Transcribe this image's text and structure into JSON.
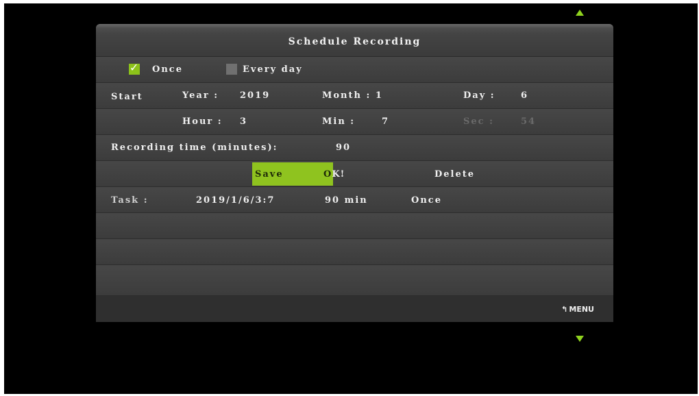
{
  "title": "Schedule Recording",
  "mode": {
    "once_label": "Once",
    "once_checked": true,
    "everyday_label": "Every day",
    "everyday_checked": false
  },
  "start": {
    "label": "Start",
    "year_label": "Year :",
    "year": "2019",
    "month_label": "Month : 1",
    "day_label": "Day :",
    "day": "6",
    "hour_label": "Hour :",
    "hour": "3",
    "min_label": "Min :",
    "min": "7",
    "sec_label": "Sec :",
    "sec": "54"
  },
  "recording": {
    "label": "Recording time (minutes):",
    "value": "90"
  },
  "actions": {
    "save_label": "Save",
    "status_o": "O",
    "status_rest": "K!",
    "delete_label": "Delete"
  },
  "task": {
    "label": "Task :",
    "datetime": "2019/1/6/3:7",
    "duration": "90 min",
    "repeat": "Once"
  },
  "footer": {
    "menu_label": "MENU",
    "menu_icon": "return-arrow-icon"
  },
  "colors": {
    "accent": "#8fc31f",
    "background": "#000000",
    "panel": "#3f3f3f"
  }
}
